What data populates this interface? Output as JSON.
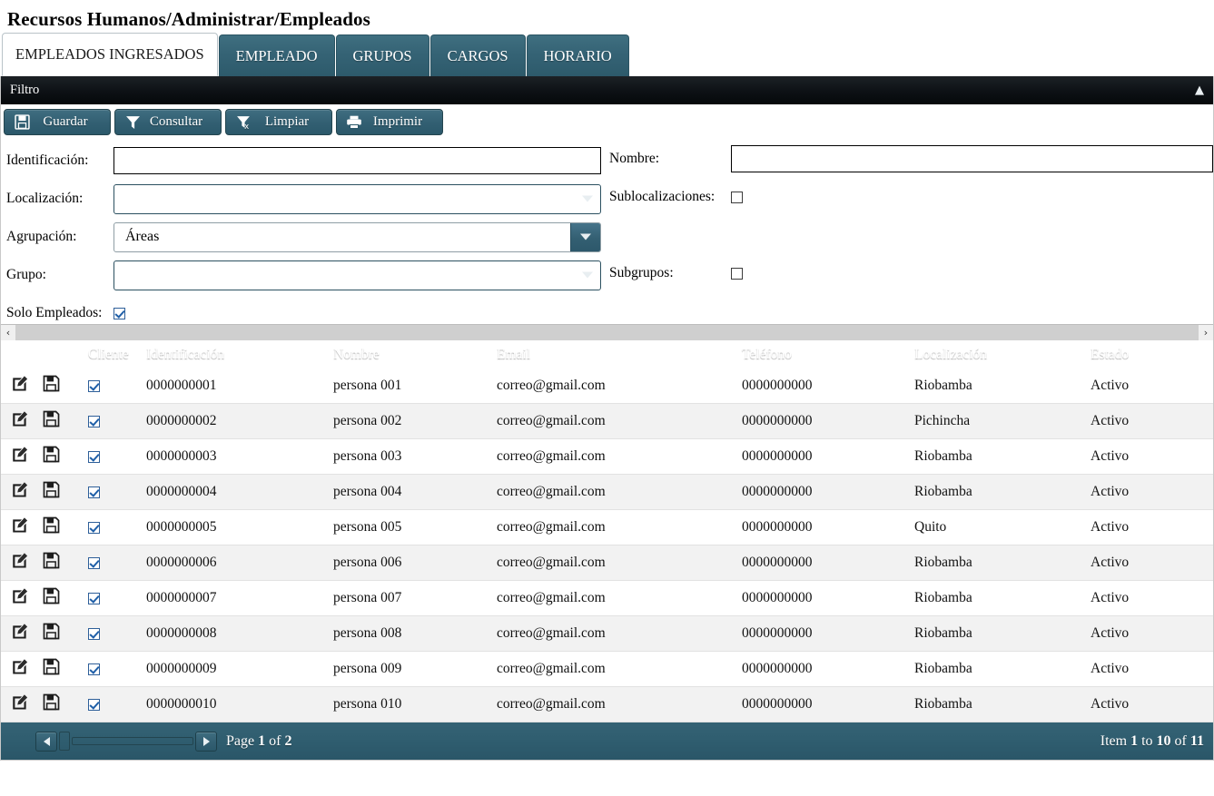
{
  "page": {
    "breadcrumb": "Recursos Humanos/Administrar/Empleados"
  },
  "tabs": [
    {
      "label": "EMPLEADOS INGRESADOS",
      "active": true
    },
    {
      "label": "EMPLEADO",
      "active": false
    },
    {
      "label": "GRUPOS",
      "active": false
    },
    {
      "label": "CARGOS",
      "active": false
    },
    {
      "label": "HORARIO",
      "active": false
    }
  ],
  "filter": {
    "title": "Filtro",
    "collapse_icon": "chevron-up-icon",
    "toolbar": [
      {
        "label": "Guardar",
        "icon": "save-icon"
      },
      {
        "label": "Consultar",
        "icon": "funnel-icon"
      },
      {
        "label": "Limpiar",
        "icon": "funnel-clear-icon"
      },
      {
        "label": "Imprimir",
        "icon": "printer-icon"
      }
    ],
    "fields": {
      "identificacion_label": "Identificación:",
      "identificacion_value": "",
      "nombre_label": "Nombre:",
      "nombre_value": "",
      "localizacion_label": "Localización:",
      "localizacion_value": "",
      "sublocalizaciones_label": "Sublocalizaciones:",
      "sublocalizaciones_checked": false,
      "agrupacion_label": "Agrupación:",
      "agrupacion_value": "Áreas",
      "grupo_label": "Grupo:",
      "grupo_value": "",
      "subgrupos_label": "Subgrupos:",
      "subgrupos_checked": false,
      "solo_empleados_label": "Solo Empleados:",
      "solo_empleados_checked": true
    }
  },
  "grid": {
    "columns": [
      "",
      "",
      "Cliente",
      "Identificación",
      "Nombre",
      "Email",
      "Teléfono",
      "Localización",
      "Estado"
    ],
    "row_icons": {
      "edit": "edit-pencil-icon",
      "save": "save-floppy-icon"
    },
    "rows": [
      {
        "cliente": true,
        "identificacion": "0000000001",
        "nombre": "persona 001",
        "email": "correo@gmail.com",
        "telefono": "0000000000",
        "localizacion": "Riobamba",
        "estado": "Activo"
      },
      {
        "cliente": true,
        "identificacion": "0000000002",
        "nombre": "persona 002",
        "email": "correo@gmail.com",
        "telefono": "0000000000",
        "localizacion": "Pichincha",
        "estado": "Activo"
      },
      {
        "cliente": true,
        "identificacion": "0000000003",
        "nombre": "persona 003",
        "email": "correo@gmail.com",
        "telefono": "0000000000",
        "localizacion": "Riobamba",
        "estado": "Activo"
      },
      {
        "cliente": true,
        "identificacion": "0000000004",
        "nombre": "persona 004",
        "email": "correo@gmail.com",
        "telefono": "0000000000",
        "localizacion": "Riobamba",
        "estado": "Activo"
      },
      {
        "cliente": true,
        "identificacion": "0000000005",
        "nombre": "persona 005",
        "email": "correo@gmail.com",
        "telefono": "0000000000",
        "localizacion": "Quito",
        "estado": "Activo"
      },
      {
        "cliente": true,
        "identificacion": "0000000006",
        "nombre": "persona 006",
        "email": "correo@gmail.com",
        "telefono": "0000000000",
        "localizacion": "Riobamba",
        "estado": "Activo"
      },
      {
        "cliente": true,
        "identificacion": "0000000007",
        "nombre": "persona 007",
        "email": "correo@gmail.com",
        "telefono": "0000000000",
        "localizacion": "Riobamba",
        "estado": "Activo"
      },
      {
        "cliente": true,
        "identificacion": "0000000008",
        "nombre": "persona 008",
        "email": "correo@gmail.com",
        "telefono": "0000000000",
        "localizacion": "Riobamba",
        "estado": "Activo"
      },
      {
        "cliente": true,
        "identificacion": "0000000009",
        "nombre": "persona 009",
        "email": "correo@gmail.com",
        "telefono": "0000000000",
        "localizacion": "Riobamba",
        "estado": "Activo"
      },
      {
        "cliente": true,
        "identificacion": "0000000010",
        "nombre": "persona 010",
        "email": "correo@gmail.com",
        "telefono": "0000000000",
        "localizacion": "Riobamba",
        "estado": "Activo"
      }
    ]
  },
  "pager": {
    "prev_icon": "triangle-left-icon",
    "next_icon": "triangle-right-icon",
    "page_text_prefix": "Page",
    "page_current": "1",
    "page_of": "of",
    "page_total": "2",
    "item_prefix": "Item",
    "item_from": "1",
    "item_to_word": "to",
    "item_to": "10",
    "item_of_word": "of",
    "item_total": "11"
  },
  "colors": {
    "accent": "#2f5d6f",
    "header_dark": "#0d1115",
    "row_alt": "#f2f2f2"
  }
}
